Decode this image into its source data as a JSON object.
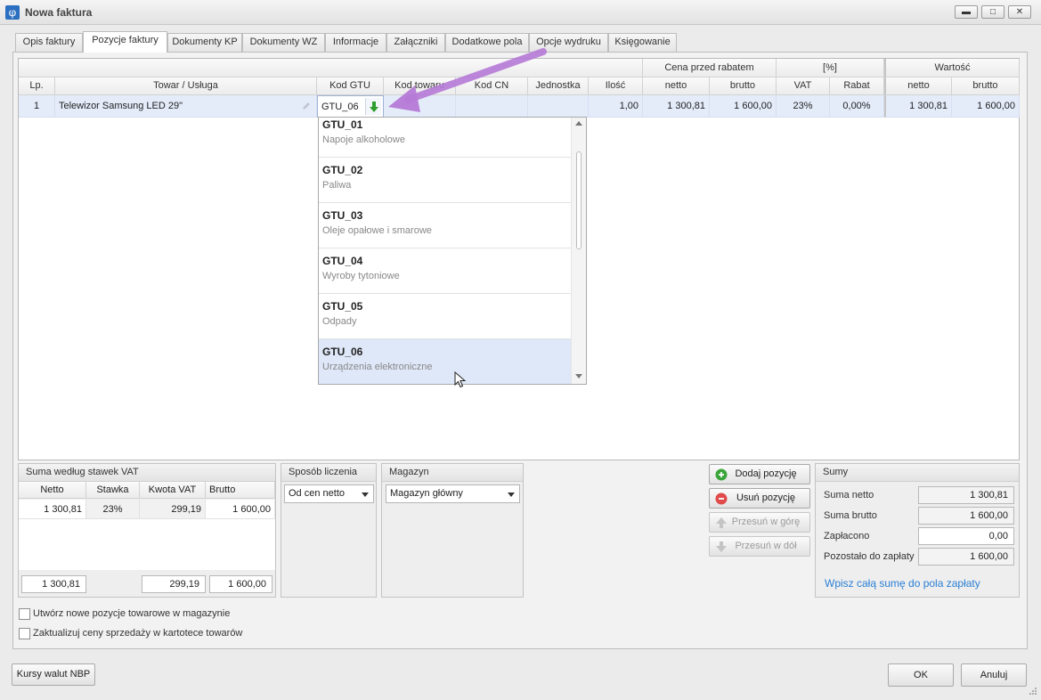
{
  "window": {
    "title": "Nowa faktura",
    "icon_glyph": "φ",
    "minimize_glyph": "▬",
    "maximize_glyph": "□",
    "close_glyph": "✕"
  },
  "tabs": [
    {
      "label": "Opis faktury"
    },
    {
      "label": "Pozycje faktury"
    },
    {
      "label": "Dokumenty KP"
    },
    {
      "label": "Dokumenty WZ"
    },
    {
      "label": "Informacje"
    },
    {
      "label": "Załączniki"
    },
    {
      "label": "Dodatkowe pola"
    },
    {
      "label": "Opcje wydruku"
    },
    {
      "label": "Księgowanie"
    }
  ],
  "grid": {
    "group_headers": {
      "cena_przed_rabatem": "Cena przed rabatem",
      "percent": "[%]",
      "wartosc": "Wartość"
    },
    "columns": {
      "lp": "Lp.",
      "towar": "Towar / Usługa",
      "kod_gtu": "Kod GTU",
      "kod_towaru": "Kod towaru",
      "kod_cn": "Kod CN",
      "jednostka": "Jednostka",
      "ilosc": "Ilość",
      "cena_netto": "netto",
      "cena_brutto": "brutto",
      "vat": "VAT",
      "rabat": "Rabat",
      "wartosc_netto": "netto",
      "wartosc_brutto": "brutto"
    },
    "row": {
      "lp": "1",
      "towar": "Telewizor Samsung LED 29\"",
      "kod_gtu": "GTU_06",
      "kod_towaru": "",
      "kod_cn": "",
      "jednostka": "",
      "ilosc": "1,00",
      "cena_netto": "1 300,81",
      "cena_brutto": "1 600,00",
      "vat": "23%",
      "rabat": "0,00%",
      "wartosc_netto": "1 300,81",
      "wartosc_brutto": "1 600,00"
    }
  },
  "gtu_dropdown": {
    "items": [
      {
        "code": "GTU_01",
        "desc": "Napoje alkoholowe"
      },
      {
        "code": "GTU_02",
        "desc": "Paliwa"
      },
      {
        "code": "GTU_03",
        "desc": "Oleje opałowe i smarowe"
      },
      {
        "code": "GTU_04",
        "desc": "Wyroby tytoniowe"
      },
      {
        "code": "GTU_05",
        "desc": "Odpady"
      },
      {
        "code": "GTU_06",
        "desc": "Urządzenia elektroniczne"
      }
    ],
    "selected": "GTU_06"
  },
  "vat_summary": {
    "title": "Suma według stawek VAT",
    "headers": {
      "netto": "Netto",
      "stawka": "Stawka",
      "kwota_vat": "Kwota VAT",
      "brutto": "Brutto"
    },
    "rows": [
      {
        "netto": "1 300,81",
        "stawka": "23%",
        "kwota_vat": "299,19",
        "brutto": "1 600,00"
      }
    ],
    "totals": {
      "netto": "1 300,81",
      "kwota_vat": "299,19",
      "brutto": "1 600,00"
    }
  },
  "sposob_liczenia": {
    "title": "Sposób liczenia",
    "value": "Od cen netto"
  },
  "magazyn": {
    "title": "Magazyn",
    "value": "Magazyn główny"
  },
  "actions": {
    "add": "Dodaj pozycję",
    "remove": "Usuń pozycję",
    "up": "Przesuń w górę",
    "down": "Przesuń w dół"
  },
  "sumy": {
    "title": "Sumy",
    "suma_netto_label": "Suma netto",
    "suma_netto": "1 300,81",
    "suma_brutto_label": "Suma brutto",
    "suma_brutto": "1 600,00",
    "zaplacono_label": "Zapłacono",
    "zaplacono": "0,00",
    "pozostalo_label": "Pozostało do zapłaty",
    "pozostalo": "1 600,00",
    "link": "Wpisz całą sumę do pola zapłaty"
  },
  "options": {
    "create_items": "Utwórz nowe pozycje towarowe w magazynie",
    "update_prices": "Zaktualizuj ceny sprzedaży w kartotece towarów"
  },
  "footer": {
    "kursy": "Kursy walut NBP",
    "ok": "OK",
    "cancel": "Anuluj"
  },
  "colors": {
    "accent_link": "#2a7fd4",
    "selection": "#e4ecfa",
    "annotation_arrow": "#b57ad6",
    "add_icon": "#3aa53a",
    "remove_icon": "#e04a4a"
  }
}
